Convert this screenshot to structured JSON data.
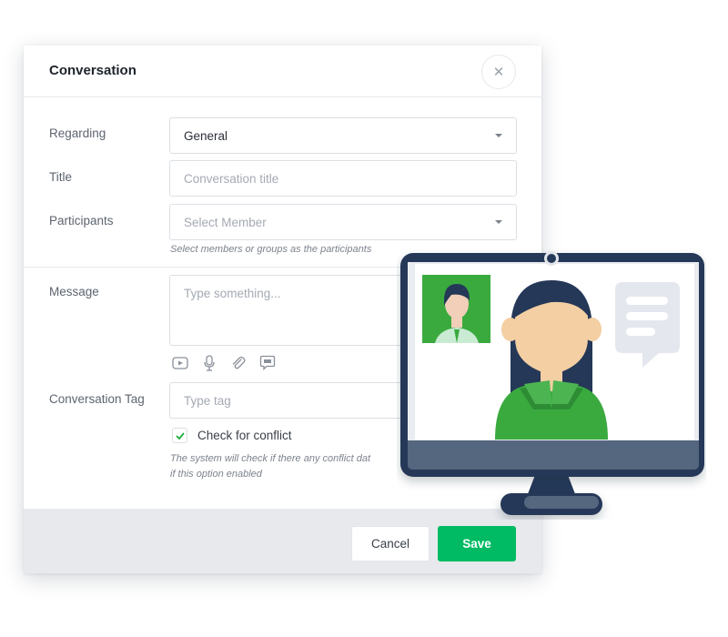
{
  "modal": {
    "title": "Conversation",
    "close_icon": "close-icon",
    "fields": {
      "regarding": {
        "label": "Regarding",
        "value": "General"
      },
      "title": {
        "label": "Title",
        "placeholder": "Conversation title"
      },
      "participants": {
        "label": "Participants",
        "placeholder": "Select Member",
        "hint": "Select members or groups as the participants"
      },
      "message": {
        "label": "Message",
        "placeholder": "Type something..."
      },
      "tag": {
        "label": "Conversation Tag",
        "placeholder": "Type tag"
      }
    },
    "message_tools": [
      "video-icon",
      "microphone-icon",
      "paperclip-icon",
      "chat-icon"
    ],
    "conflict": {
      "label": "Check for conflict",
      "checked": true,
      "hint_line1": "The system will check if there any conflict dat",
      "hint_line2": "if this option enabled"
    },
    "footer": {
      "cancel_label": "Cancel",
      "save_label": "Save"
    }
  },
  "colors": {
    "accent_green": "#00bb63",
    "monitor_navy": "#253858",
    "figure_green": "#3aaa3f",
    "skin": "#f3cfa3"
  }
}
